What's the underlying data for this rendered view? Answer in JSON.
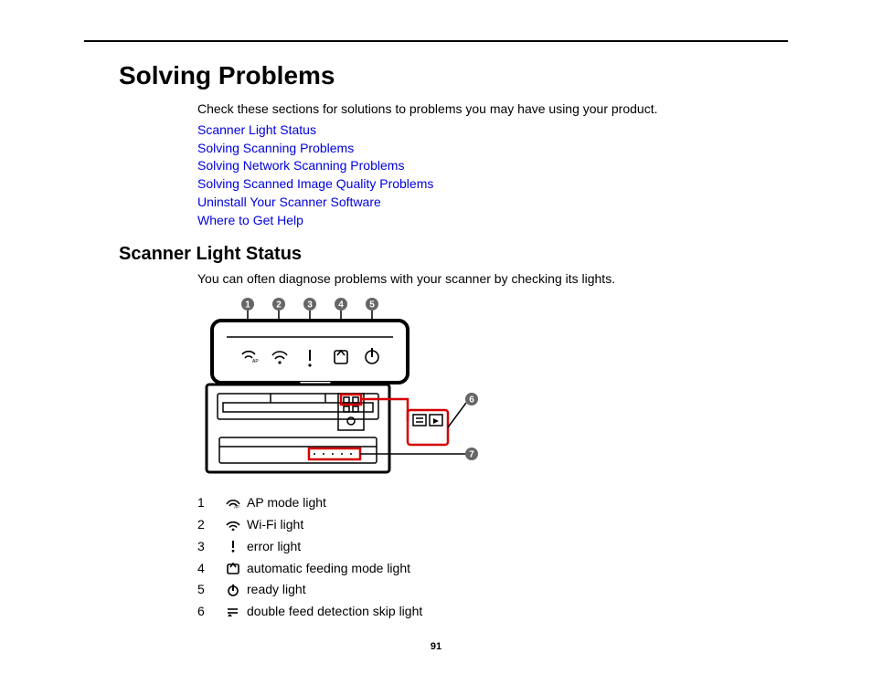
{
  "page": {
    "title": "Solving Problems",
    "intro": "Check these sections for solutions to problems you may have using your product.",
    "page_number": "91"
  },
  "links": [
    "Scanner Light Status",
    "Solving Scanning Problems",
    "Solving Network Scanning Problems",
    "Solving Scanned Image Quality Problems",
    "Uninstall Your Scanner Software",
    "Where to Get Help"
  ],
  "section": {
    "heading": "Scanner Light Status",
    "intro": "You can often diagnose problems with your scanner by checking its lights."
  },
  "callouts": {
    "c1": "1",
    "c2": "2",
    "c3": "3",
    "c4": "4",
    "c5": "5",
    "c6": "6",
    "c7": "7"
  },
  "legend": [
    {
      "num": "1",
      "icon": "ap-mode-icon",
      "label": " AP mode light"
    },
    {
      "num": "2",
      "icon": "wifi-icon",
      "label": " Wi-Fi light"
    },
    {
      "num": "3",
      "icon": "error-icon",
      "label": " error light"
    },
    {
      "num": "4",
      "icon": "afm-icon",
      "label": " automatic feeding mode light"
    },
    {
      "num": "5",
      "icon": "ready-icon",
      "label": " ready light"
    },
    {
      "num": "6",
      "icon": "dfd-skip-icon",
      "label": " double feed detection skip light"
    }
  ]
}
